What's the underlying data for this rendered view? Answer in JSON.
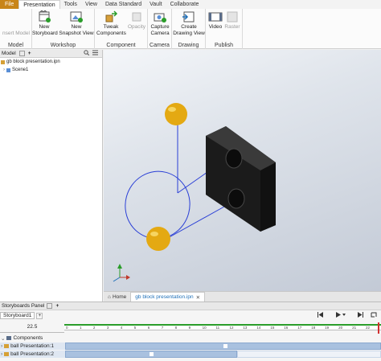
{
  "menu": {
    "items": [
      "File",
      "Presentation",
      "Tools",
      "View",
      "Data Standard",
      "Vault",
      "Collaborate"
    ],
    "active": "Presentation"
  },
  "ribbon": {
    "model": {
      "label": "Model",
      "insert_model": "nsert Model"
    },
    "workshop": {
      "label": "Workshop",
      "new_storyboard": [
        "New",
        "Storyboard"
      ],
      "new_snapshot": [
        "New",
        "Snapshot View"
      ]
    },
    "component": {
      "label": "Component",
      "tweak": [
        "Tweak",
        "Components"
      ],
      "opacity": "Opacity"
    },
    "camera": {
      "label": "Camera",
      "capture": [
        "Capture",
        "Camera"
      ]
    },
    "drawing": {
      "label": "Drawing",
      "create": [
        "Create",
        "Drawing View"
      ]
    },
    "publish": {
      "label": "Publish",
      "video": "Video",
      "raster": "Raster"
    }
  },
  "browser": {
    "tab": "Model",
    "add": "+",
    "root": "gb block presentation.ipn",
    "child": "Scene1"
  },
  "doc_tabs": {
    "home": "Home",
    "active": "gb block presentation.ipn"
  },
  "storyboard": {
    "panel_title": "Storyboards Panel",
    "add": "+",
    "tab": "Storyboard1",
    "time_value": "22.5",
    "rows": [
      {
        "label": "Components"
      },
      {
        "label": "ball Presentation:1"
      },
      {
        "label": "ball Presentation:2"
      }
    ],
    "ruler_ticks": [
      "0",
      "1",
      "2",
      "3",
      "4",
      "5",
      "6",
      "7",
      "8",
      "9",
      "10",
      "11",
      "12",
      "13",
      "14",
      "15",
      "16",
      "17",
      "18",
      "19",
      "20",
      "21",
      "22"
    ]
  },
  "colors": {
    "file_tab": "#c8851a",
    "ball": "#e4a912",
    "block": "#1b1b1b",
    "path": "#2a3fd6",
    "timeline_marker": "#2a9d2a",
    "bar": "#a9c1df",
    "accent": "#1e6fb8"
  }
}
